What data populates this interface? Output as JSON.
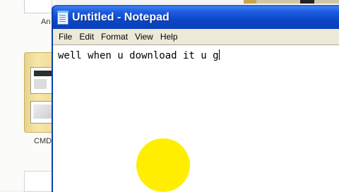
{
  "desktop": {
    "items": [
      {
        "label": "An"
      },
      {
        "label": "CMD"
      }
    ]
  },
  "window": {
    "title": "Untitled - Notepad",
    "icon": "notepad-icon",
    "menu": [
      "File",
      "Edit",
      "Format",
      "View",
      "Help"
    ],
    "content": "well when u download it u g"
  },
  "overlay": {
    "cursor_highlight_color": "#ffee00"
  },
  "colors": {
    "titlebar": "#0b47c9",
    "menubar": "#ece9d8",
    "editor_bg": "#ffffff"
  }
}
